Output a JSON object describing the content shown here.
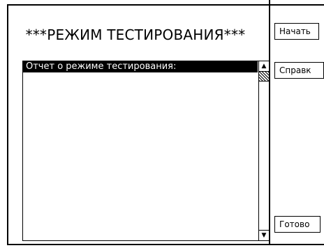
{
  "dialog": {
    "title": "***РЕЖИМ ТЕСТИРОВАНИЯ***"
  },
  "report": {
    "header": "Отчет о режиме тестирования:",
    "lines": [],
    "scroll_up_glyph": "▲",
    "scroll_down_glyph": "▼"
  },
  "buttons": {
    "start": "Начать",
    "help": "Справк",
    "done": "Готово"
  },
  "icons": {
    "scroll_up": "scroll-up-arrow-icon",
    "scroll_down": "scroll-down-arrow-icon"
  }
}
